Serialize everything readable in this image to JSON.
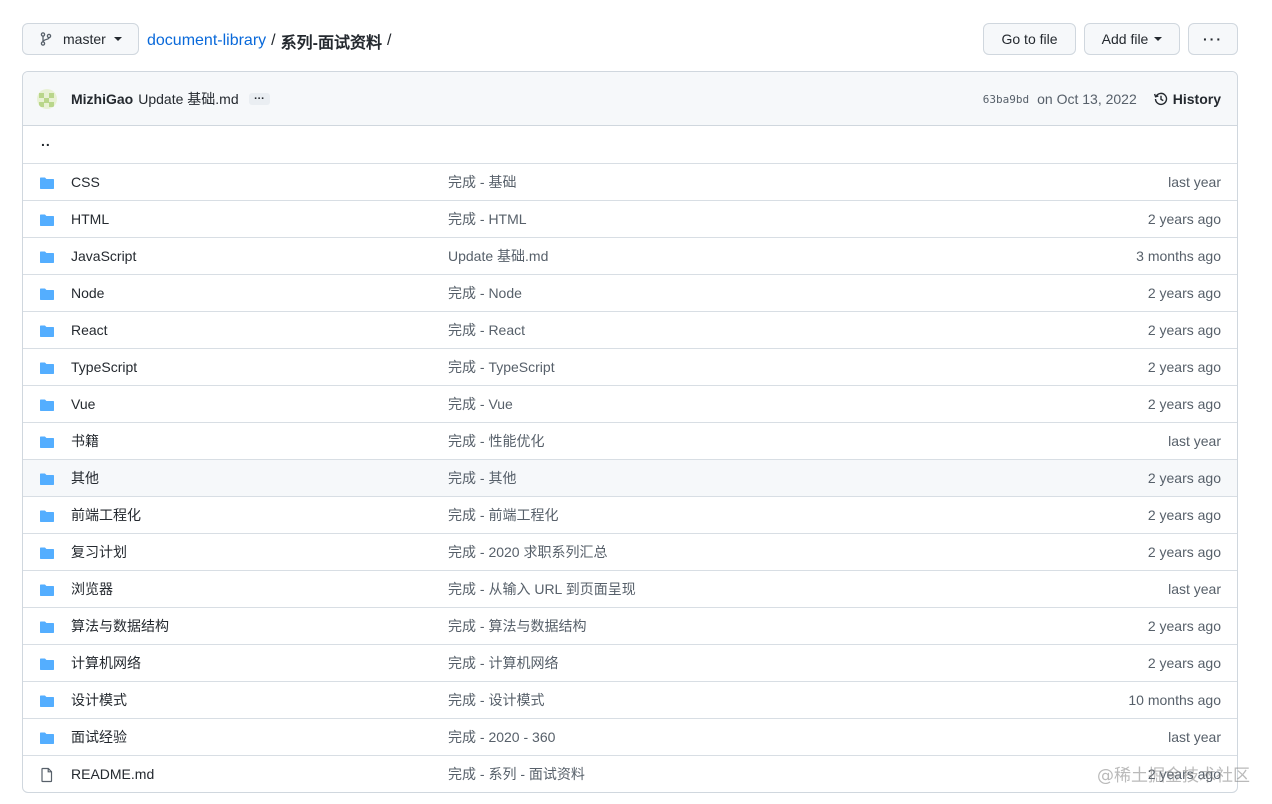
{
  "toolbar": {
    "branch": "master",
    "repo": "document-library",
    "separator": "/",
    "current_dir": "系列-面试资料",
    "trailing_separator": "/",
    "goto_file": "Go to file",
    "add_file": "Add file",
    "more": "···"
  },
  "commit": {
    "author": "MizhiGao",
    "message": "Update 基础.md",
    "ellipsis": "…",
    "sha": "63ba9bd",
    "date": "on Oct 13, 2022",
    "history": "History"
  },
  "parent_dir": "..",
  "files": [
    {
      "type": "dir",
      "name": "CSS",
      "message": "完成 - 基础",
      "age": "last year"
    },
    {
      "type": "dir",
      "name": "HTML",
      "message": "完成 - HTML",
      "age": "2 years ago"
    },
    {
      "type": "dir",
      "name": "JavaScript",
      "message": "Update 基础.md",
      "age": "3 months ago"
    },
    {
      "type": "dir",
      "name": "Node",
      "message": "完成 - Node",
      "age": "2 years ago"
    },
    {
      "type": "dir",
      "name": "React",
      "message": "完成 - React",
      "age": "2 years ago"
    },
    {
      "type": "dir",
      "name": "TypeScript",
      "message": "完成 - TypeScript",
      "age": "2 years ago"
    },
    {
      "type": "dir",
      "name": "Vue",
      "message": "完成 - Vue",
      "age": "2 years ago"
    },
    {
      "type": "dir",
      "name": "书籍",
      "message": "完成 - 性能优化",
      "age": "last year"
    },
    {
      "type": "dir",
      "name": "其他",
      "message": "完成 - 其他",
      "age": "2 years ago"
    },
    {
      "type": "dir",
      "name": "前端工程化",
      "message": "完成 - 前端工程化",
      "age": "2 years ago"
    },
    {
      "type": "dir",
      "name": "复习计划",
      "message": "完成 - 2020 求职系列汇总",
      "age": "2 years ago"
    },
    {
      "type": "dir",
      "name": "浏览器",
      "message": "完成 - 从输入 URL 到页面呈现",
      "age": "last year"
    },
    {
      "type": "dir",
      "name": "算法与数据结构",
      "message": "完成 - 算法与数据结构",
      "age": "2 years ago"
    },
    {
      "type": "dir",
      "name": "计算机网络",
      "message": "完成 - 计算机网络",
      "age": "2 years ago"
    },
    {
      "type": "dir",
      "name": "设计模式",
      "message": "完成 - 设计模式",
      "age": "10 months ago"
    },
    {
      "type": "dir",
      "name": "面试经验",
      "message": "完成 - 2020 - 360",
      "age": "last year"
    },
    {
      "type": "file",
      "name": "README.md",
      "message": "完成 - 系列 - 面试资料",
      "age": "2 years ago"
    }
  ],
  "watermark": "@稀土掘金技术社区",
  "colors": {
    "folder": "#54aeff",
    "link": "#0969da"
  }
}
